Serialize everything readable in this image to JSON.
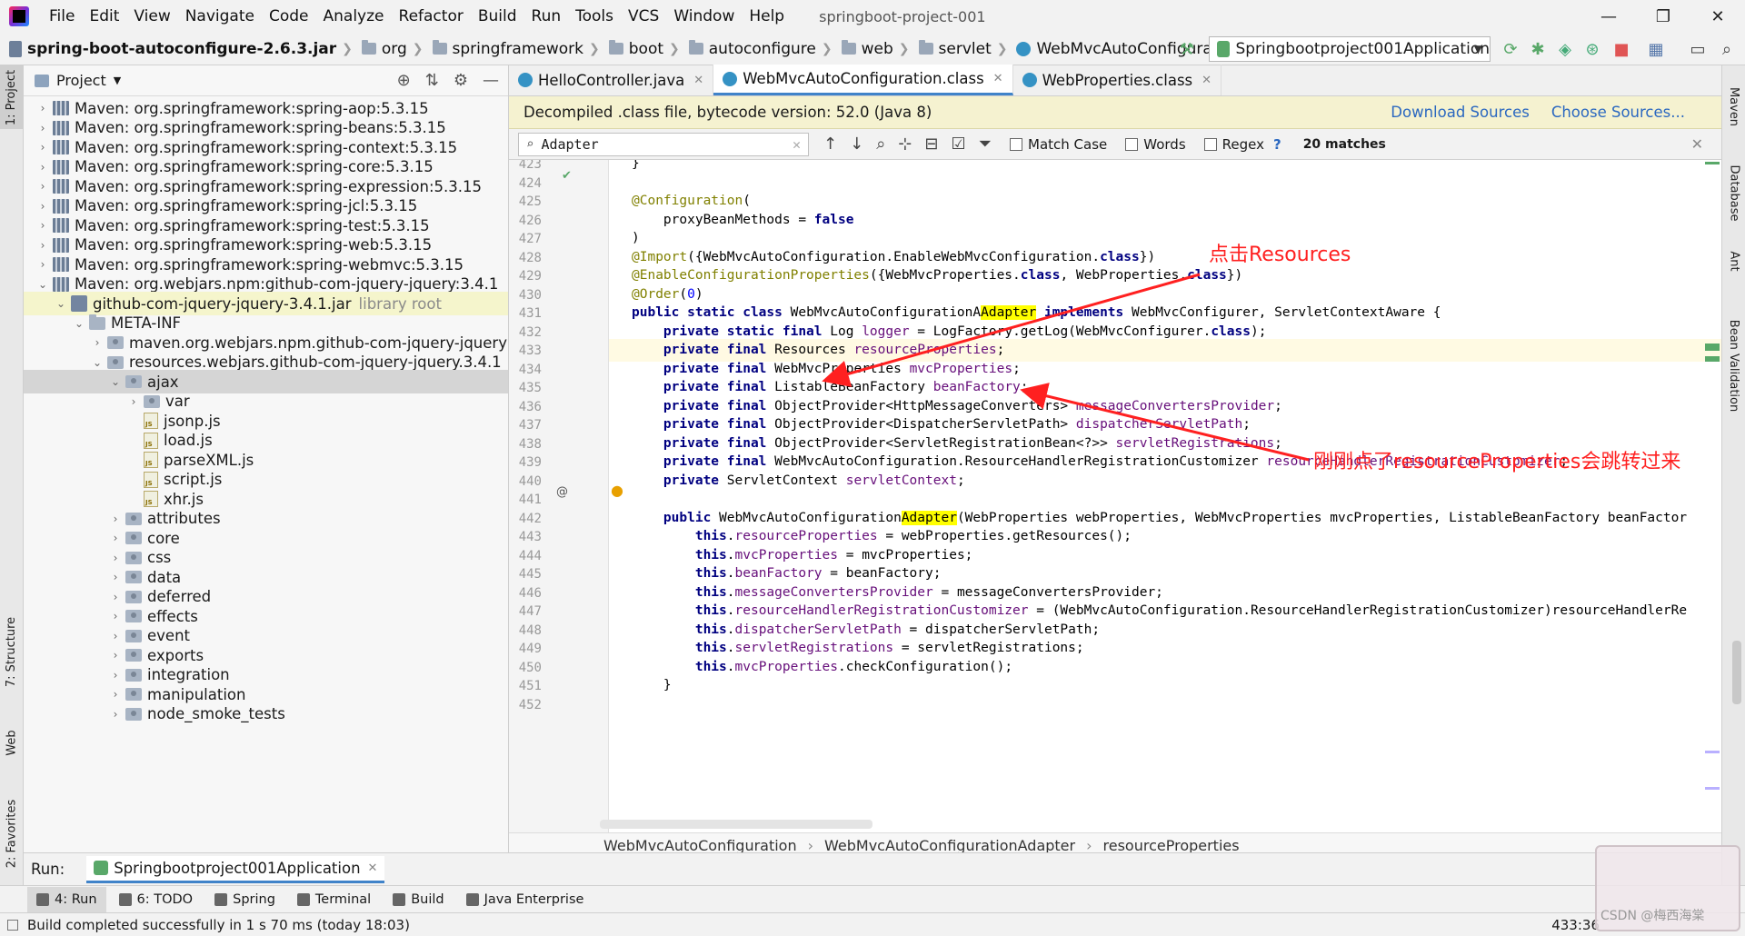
{
  "menubar": {
    "items": [
      "File",
      "Edit",
      "View",
      "Navigate",
      "Code",
      "Analyze",
      "Refactor",
      "Build",
      "Run",
      "Tools",
      "VCS",
      "Window",
      "Help"
    ],
    "window_title": "springboot-project-001"
  },
  "navbar": {
    "crumbs": [
      "spring-boot-autoconfigure-2.6.3.jar",
      "org",
      "springframework",
      "boot",
      "autoconfigure",
      "web",
      "servlet",
      "WebMvcAutoConfiguration"
    ],
    "run_config": "Springbootproject001Application"
  },
  "project": {
    "title": "Project",
    "rows": [
      {
        "indent": 0,
        "arrow": "›",
        "icon": "lib",
        "label": "Maven: org.springframework:spring-aop:5.3.15"
      },
      {
        "indent": 0,
        "arrow": "›",
        "icon": "lib",
        "label": "Maven: org.springframework:spring-beans:5.3.15"
      },
      {
        "indent": 0,
        "arrow": "›",
        "icon": "lib",
        "label": "Maven: org.springframework:spring-context:5.3.15"
      },
      {
        "indent": 0,
        "arrow": "›",
        "icon": "lib",
        "label": "Maven: org.springframework:spring-core:5.3.15"
      },
      {
        "indent": 0,
        "arrow": "›",
        "icon": "lib",
        "label": "Maven: org.springframework:spring-expression:5.3.15"
      },
      {
        "indent": 0,
        "arrow": "›",
        "icon": "lib",
        "label": "Maven: org.springframework:spring-jcl:5.3.15"
      },
      {
        "indent": 0,
        "arrow": "›",
        "icon": "lib",
        "label": "Maven: org.springframework:spring-test:5.3.15"
      },
      {
        "indent": 0,
        "arrow": "›",
        "icon": "lib",
        "label": "Maven: org.springframework:spring-web:5.3.15"
      },
      {
        "indent": 0,
        "arrow": "›",
        "icon": "lib",
        "label": "Maven: org.springframework:spring-webmvc:5.3.15"
      },
      {
        "indent": 0,
        "arrow": "⌄",
        "icon": "lib",
        "label": "Maven: org.webjars.npm:github-com-jquery-jquery:3.4.1"
      },
      {
        "indent": 1,
        "arrow": "⌄",
        "icon": "jar",
        "label": "github-com-jquery-jquery-3.4.1.jar",
        "suffix": "library root",
        "hl": true
      },
      {
        "indent": 2,
        "arrow": "⌄",
        "icon": "folder",
        "label": "META-INF"
      },
      {
        "indent": 3,
        "arrow": "›",
        "icon": "pkg",
        "label": "maven.org.webjars.npm.github-com-jquery-jquery"
      },
      {
        "indent": 3,
        "arrow": "⌄",
        "icon": "pkg",
        "label": "resources.webjars.github-com-jquery-jquery.3.4.1"
      },
      {
        "indent": 4,
        "arrow": "⌄",
        "icon": "pkg",
        "label": "ajax",
        "sel": true
      },
      {
        "indent": 5,
        "arrow": "›",
        "icon": "pkg",
        "label": "var"
      },
      {
        "indent": 5,
        "arrow": "",
        "icon": "js",
        "label": "jsonp.js"
      },
      {
        "indent": 5,
        "arrow": "",
        "icon": "js",
        "label": "load.js"
      },
      {
        "indent": 5,
        "arrow": "",
        "icon": "js",
        "label": "parseXML.js"
      },
      {
        "indent": 5,
        "arrow": "",
        "icon": "js",
        "label": "script.js"
      },
      {
        "indent": 5,
        "arrow": "",
        "icon": "js",
        "label": "xhr.js"
      },
      {
        "indent": 4,
        "arrow": "›",
        "icon": "pkg",
        "label": "attributes"
      },
      {
        "indent": 4,
        "arrow": "›",
        "icon": "pkg",
        "label": "core"
      },
      {
        "indent": 4,
        "arrow": "›",
        "icon": "pkg",
        "label": "css"
      },
      {
        "indent": 4,
        "arrow": "›",
        "icon": "pkg",
        "label": "data"
      },
      {
        "indent": 4,
        "arrow": "›",
        "icon": "pkg",
        "label": "deferred"
      },
      {
        "indent": 4,
        "arrow": "›",
        "icon": "pkg",
        "label": "effects"
      },
      {
        "indent": 4,
        "arrow": "›",
        "icon": "pkg",
        "label": "event"
      },
      {
        "indent": 4,
        "arrow": "›",
        "icon": "pkg",
        "label": "exports"
      },
      {
        "indent": 4,
        "arrow": "›",
        "icon": "pkg",
        "label": "integration"
      },
      {
        "indent": 4,
        "arrow": "›",
        "icon": "pkg",
        "label": "manipulation"
      },
      {
        "indent": 4,
        "arrow": "›",
        "icon": "pkg",
        "label": "node_smoke_tests"
      }
    ]
  },
  "editor": {
    "tabs": [
      {
        "label": "HelloController.java",
        "active": false
      },
      {
        "label": "WebMvcAutoConfiguration.class",
        "active": true
      },
      {
        "label": "WebProperties.class",
        "active": false
      }
    ],
    "banner": "Decompiled .class file, bytecode version: 52.0 (Java 8)",
    "banner_links": [
      "Download Sources",
      "Choose Sources..."
    ],
    "search": {
      "query": "Adapter",
      "options": [
        "Match Case",
        "Words",
        "Regex"
      ],
      "help": "?",
      "matches": "20 matches"
    },
    "lines": [
      {
        "n": "423",
        "html": "}"
      },
      {
        "n": "424",
        "html": ""
      },
      {
        "n": "425",
        "html": "<span class='ann'>@Configuration</span>("
      },
      {
        "n": "426",
        "html": "    proxyBeanMethods = <span class='kw'>false</span>"
      },
      {
        "n": "427",
        "html": ")"
      },
      {
        "n": "428",
        "html": "<span class='ann'>@Import</span>({WebMvcAutoConfiguration.EnableWebMvcConfiguration.<span class='kw'>class</span>})"
      },
      {
        "n": "429",
        "html": "<span class='ann'>@EnableConfigurationProperties</span>({WebMvcProperties.<span class='kw'>class</span>, WebProperties.<span class='kw'>class</span>})"
      },
      {
        "n": "430",
        "html": "<span class='ann'>@Order</span>(<span class='num'>0</span>)"
      },
      {
        "n": "431",
        "html": "<span class='kw'>public static class</span> WebMvcAutoConfigurationA<span class='match'>Adapter</span> <span class='kw'>implements</span> WebMvcConfigurer, ServletContextAware {"
      },
      {
        "n": "432",
        "html": "    <span class='kw'>private static final</span> Log <span class='fld'>logger</span> = LogFactory.getLog(WebMvcConfigurer.<span class='kw'>class</span>);"
      },
      {
        "n": "433",
        "html": "    <span class='kw'>private final</span> Resources <span class='fld'>resourceProperties</span>;"
      },
      {
        "n": "434",
        "html": "    <span class='kw'>private final</span> WebMvcProperties <span class='fld'>mvcProperties</span>;"
      },
      {
        "n": "435",
        "html": "    <span class='kw'>private final</span> ListableBeanFactory <span class='fld'>beanFactory</span>;"
      },
      {
        "n": "436",
        "html": "    <span class='kw'>private final</span> ObjectProvider&lt;HttpMessageConverters&gt; <span class='fld'>messageConvertersProvider</span>;"
      },
      {
        "n": "437",
        "html": "    <span class='kw'>private final</span> ObjectProvider&lt;DispatcherServletPath&gt; <span class='fld'>dispatcherServletPath</span>;"
      },
      {
        "n": "438",
        "html": "    <span class='kw'>private final</span> ObjectProvider&lt;ServletRegistrationBean&lt;?&gt;&gt; <span class='fld'>servletRegistrations</span>;"
      },
      {
        "n": "439",
        "html": "    <span class='kw'>private final</span> WebMvcAutoConfiguration.ResourceHandlerRegistrationCustomizer <span class='fld'>resourceHandlerRegistrationCustomizer</span>;"
      },
      {
        "n": "440",
        "html": "    <span class='kw'>private</span> ServletContext <span class='fld'>servletContext</span>;"
      },
      {
        "n": "441",
        "html": ""
      },
      {
        "n": "442",
        "html": "    <span class='kw'>public</span> WebMvcAutoConfiguration<span class='match'>Adapter</span>(WebProperties webProperties, WebMvcProperties mvcProperties, ListableBeanFactory beanFactor"
      },
      {
        "n": "443",
        "html": "        <span class='kw'>this</span>.<span class='fld'>resourceProperties</span> = webProperties.getResources();"
      },
      {
        "n": "444",
        "html": "        <span class='kw'>this</span>.<span class='fld'>mvcProperties</span> = mvcProperties;"
      },
      {
        "n": "445",
        "html": "        <span class='kw'>this</span>.<span class='fld'>beanFactory</span> = beanFactory;"
      },
      {
        "n": "446",
        "html": "        <span class='kw'>this</span>.<span class='fld'>messageConvertersProvider</span> = messageConvertersProvider;"
      },
      {
        "n": "447",
        "html": "        <span class='kw'>this</span>.<span class='fld'>resourceHandlerRegistrationCustomizer</span> = (WebMvcAutoConfiguration.ResourceHandlerRegistrationCustomizer)resourceHandlerRe"
      },
      {
        "n": "448",
        "html": "        <span class='kw'>this</span>.<span class='fld'>dispatcherServletPath</span> = dispatcherServletPath;"
      },
      {
        "n": "449",
        "html": "        <span class='kw'>this</span>.<span class='fld'>servletRegistrations</span> = servletRegistrations;"
      },
      {
        "n": "450",
        "html": "        <span class='kw'>this</span>.<span class='fld'>mvcProperties</span>.checkConfiguration();"
      },
      {
        "n": "451",
        "html": "    }"
      },
      {
        "n": "452",
        "html": ""
      }
    ],
    "breadcrumb": [
      "WebMvcAutoConfiguration",
      "WebMvcAutoConfigurationAdapter",
      "resourceProperties"
    ]
  },
  "annotations": {
    "click_resources": "点击Resources",
    "jumped_here": "刚刚点了resourceProperties会跳转过来"
  },
  "left_strip": [
    "1: Project",
    "7: Structure",
    "Web",
    "2: Favorites"
  ],
  "right_strip": [
    "Maven",
    "Database",
    "Ant",
    "Bean Validation"
  ],
  "runbar": {
    "label": "Run:",
    "tab": "Springbootproject001Application"
  },
  "tooltabs": [
    "4: Run",
    "6: TODO",
    "Spring",
    "Terminal",
    "Build",
    "Java Enterprise"
  ],
  "statusbar": {
    "message": "Build completed successfully in 1 s 70 ms (today 18:03)",
    "position": "433:36"
  },
  "watermark": "CSDN @梅西海棠",
  "colors": {
    "accent": "#4083c9",
    "annotation": "#ff2020",
    "match": "#ffff00"
  }
}
